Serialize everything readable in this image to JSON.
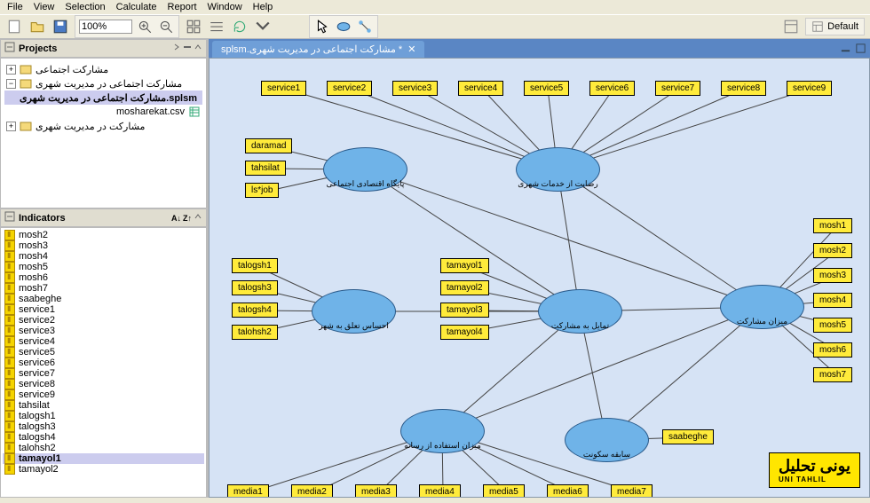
{
  "menu": [
    "File",
    "View",
    "Selection",
    "Calculate",
    "Report",
    "Window",
    "Help"
  ],
  "zoom": "100%",
  "default": "Default",
  "projects_title": "Projects",
  "indicators_title": "Indicators",
  "projects": {
    "root1": "مشارکت اجتماعی",
    "root2": "مشارکت اجتماعی در مدیریت شهری",
    "child1": "splsm.مشارکت اجتماعی در مدیریت شهری",
    "child2": "mosharekat.csv",
    "root3": "مشارکت در مدیریت شهری"
  },
  "tab_label": "splsm.مشارکت اجتماعی در مدیریت شهری *",
  "indicators": [
    "mosh2",
    "mosh3",
    "mosh4",
    "mosh5",
    "mosh6",
    "mosh7",
    "saabeghe",
    "service1",
    "service2",
    "service3",
    "service4",
    "service5",
    "service6",
    "service7",
    "service8",
    "service9",
    "tahsilat",
    "talogsh1",
    "talogsh3",
    "talogsh4",
    "talohsh2",
    "tamayol1",
    "tamayol2"
  ],
  "indicator_sel_index": 21,
  "latents": {
    "paygah": "پایگاه اقتصادی اجتماعی",
    "rezayat": "رضایت از خدمات شهری",
    "ehsas": "احساس تعلق به شهر",
    "tamayol": "تمایل به مشارکت",
    "mizan": "میزان مشارکت",
    "resane": "میزان استفاده از رسانه",
    "sabeghe": "سابقه سکونت"
  },
  "mv": {
    "daramad": "daramad",
    "tahsilat": "tahsilat",
    "job": "ls*job",
    "talogsh1": "talogsh1",
    "talogsh3": "talogsh3",
    "talogsh4": "talogsh4",
    "talohsh2": "talohsh2",
    "s1": "service1",
    "s2": "service2",
    "s3": "service3",
    "s4": "service4",
    "s5": "service5",
    "s6": "service6",
    "s7": "service7",
    "s8": "service8",
    "s9": "service9",
    "t1": "tamayol1",
    "t2": "tamayol2",
    "t3": "tamayol3",
    "t4": "tamayol4",
    "m1": "mosh1",
    "m2": "mosh2",
    "m3": "mosh3",
    "m4": "mosh4",
    "m5": "mosh5",
    "m6": "mosh6",
    "m7": "mosh7",
    "md1": "media1",
    "md2": "media2",
    "md3": "media3",
    "md4": "media4",
    "md5": "media5",
    "md6": "media6",
    "md7": "media7",
    "saab": "saabeghe"
  },
  "logo_main": "یونی تحلیل",
  "logo_sub": "UNI TAHLIL"
}
